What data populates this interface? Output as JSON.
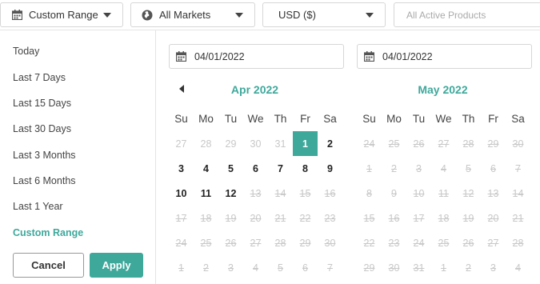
{
  "filters": {
    "range": {
      "label": "Custom Range",
      "icon": "calendar-icon"
    },
    "markets": {
      "label": "All Markets",
      "icon": "globe-icon"
    },
    "currency": {
      "label": "USD ($)"
    },
    "products": {
      "placeholder": "All Active Products"
    }
  },
  "presets": [
    {
      "label": "Today",
      "active": false
    },
    {
      "label": "Last 7 Days",
      "active": false
    },
    {
      "label": "Last 15 Days",
      "active": false
    },
    {
      "label": "Last 30 Days",
      "active": false
    },
    {
      "label": "Last 3 Months",
      "active": false
    },
    {
      "label": "Last 6 Months",
      "active": false
    },
    {
      "label": "Last 1 Year",
      "active": false
    },
    {
      "label": "Custom Range",
      "active": true
    }
  ],
  "buttons": {
    "cancel": "Cancel",
    "apply": "Apply"
  },
  "date_inputs": {
    "start": "04/01/2022",
    "end": "04/01/2022"
  },
  "weekdays": [
    "Su",
    "Mo",
    "Tu",
    "We",
    "Th",
    "Fr",
    "Sa"
  ],
  "calendars": [
    {
      "title": "Apr 2022",
      "has_prev": true,
      "weeks": [
        [
          [
            "27",
            "off"
          ],
          [
            "28",
            "off"
          ],
          [
            "29",
            "off"
          ],
          [
            "30",
            "off"
          ],
          [
            "31",
            "off"
          ],
          [
            "1",
            "sel"
          ],
          [
            "2",
            "cur"
          ]
        ],
        [
          [
            "3",
            "cur"
          ],
          [
            "4",
            "cur"
          ],
          [
            "5",
            "cur"
          ],
          [
            "6",
            "cur"
          ],
          [
            "7",
            "cur"
          ],
          [
            "8",
            "cur"
          ],
          [
            "9",
            "cur"
          ]
        ],
        [
          [
            "10",
            "cur"
          ],
          [
            "11",
            "cur"
          ],
          [
            "12",
            "cur"
          ],
          [
            "13",
            "dis"
          ],
          [
            "14",
            "dis"
          ],
          [
            "15",
            "dis"
          ],
          [
            "16",
            "dis"
          ]
        ],
        [
          [
            "17",
            "dis"
          ],
          [
            "18",
            "dis"
          ],
          [
            "19",
            "dis"
          ],
          [
            "20",
            "dis"
          ],
          [
            "21",
            "dis"
          ],
          [
            "22",
            "dis"
          ],
          [
            "23",
            "dis"
          ]
        ],
        [
          [
            "24",
            "dis"
          ],
          [
            "25",
            "dis"
          ],
          [
            "26",
            "dis"
          ],
          [
            "27",
            "dis"
          ],
          [
            "28",
            "dis"
          ],
          [
            "29",
            "dis"
          ],
          [
            "30",
            "dis"
          ]
        ],
        [
          [
            "1",
            "dis"
          ],
          [
            "2",
            "dis"
          ],
          [
            "3",
            "dis"
          ],
          [
            "4",
            "dis"
          ],
          [
            "5",
            "dis"
          ],
          [
            "6",
            "dis"
          ],
          [
            "7",
            "dis"
          ]
        ]
      ]
    },
    {
      "title": "May 2022",
      "has_prev": false,
      "weeks": [
        [
          [
            "24",
            "dis"
          ],
          [
            "25",
            "dis"
          ],
          [
            "26",
            "dis"
          ],
          [
            "27",
            "dis"
          ],
          [
            "28",
            "dis"
          ],
          [
            "29",
            "dis"
          ],
          [
            "30",
            "dis"
          ]
        ],
        [
          [
            "1",
            "dis"
          ],
          [
            "2",
            "dis"
          ],
          [
            "3",
            "dis"
          ],
          [
            "4",
            "dis"
          ],
          [
            "5",
            "dis"
          ],
          [
            "6",
            "dis"
          ],
          [
            "7",
            "dis"
          ]
        ],
        [
          [
            "8",
            "dis"
          ],
          [
            "9",
            "dis"
          ],
          [
            "10",
            "dis"
          ],
          [
            "11",
            "dis"
          ],
          [
            "12",
            "dis"
          ],
          [
            "13",
            "dis"
          ],
          [
            "14",
            "dis"
          ]
        ],
        [
          [
            "15",
            "dis"
          ],
          [
            "16",
            "dis"
          ],
          [
            "17",
            "dis"
          ],
          [
            "18",
            "dis"
          ],
          [
            "19",
            "dis"
          ],
          [
            "20",
            "dis"
          ],
          [
            "21",
            "dis"
          ]
        ],
        [
          [
            "22",
            "dis"
          ],
          [
            "23",
            "dis"
          ],
          [
            "24",
            "dis"
          ],
          [
            "25",
            "dis"
          ],
          [
            "26",
            "dis"
          ],
          [
            "27",
            "dis"
          ],
          [
            "28",
            "dis"
          ]
        ],
        [
          [
            "29",
            "dis"
          ],
          [
            "30",
            "dis"
          ],
          [
            "31",
            "dis"
          ],
          [
            "1",
            "dis"
          ],
          [
            "2",
            "dis"
          ],
          [
            "3",
            "dis"
          ],
          [
            "4",
            "dis"
          ]
        ]
      ]
    }
  ],
  "colors": {
    "accent": "#3ea89b",
    "disabled": "#c8c8c8"
  }
}
